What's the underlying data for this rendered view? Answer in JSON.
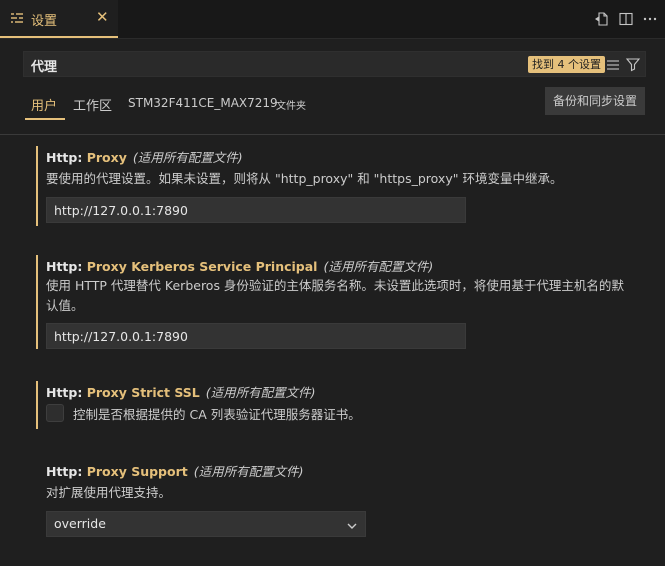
{
  "tab": {
    "label": "设置",
    "close": "✕"
  },
  "search": {
    "value": "代理",
    "badge": "找到 4 个设置"
  },
  "scopes": {
    "user": "用户",
    "workspace": "工作区",
    "folder": "STM32F411CE_MAX7219",
    "folder_suffix": "文件夹",
    "sync_button": "备份和同步设置"
  },
  "settings": [
    {
      "category": "Http: ",
      "key": "Proxy",
      "scope_note": "(适用所有配置文件)",
      "description": "要使用的代理设置。如果未设置，则将从 \"http_proxy\" 和 \"https_proxy\" 环境变量中继承。",
      "value": "http://127.0.0.1:7890"
    },
    {
      "category": "Http: ",
      "key": "Proxy Kerberos Service Principal",
      "scope_note": "(适用所有配置文件)",
      "description": "使用 HTTP 代理替代 Kerberos 身份验证的主体服务名称。未设置此选项时，将使用基于代理主机名的默认值。",
      "value": "http://127.0.0.1:7890"
    },
    {
      "category": "Http: ",
      "key": "Proxy Strict SSL",
      "scope_note": "(适用所有配置文件)",
      "checkbox_label": "控制是否根据提供的 CA 列表验证代理服务器证书。",
      "checked": false
    },
    {
      "category": "Http: ",
      "key": "Proxy Support",
      "scope_note": "(适用所有配置文件)",
      "description": "对扩展使用代理支持。",
      "value": "override"
    }
  ],
  "colors": {
    "accent": "#e5c07b",
    "background": "#1f1f1f"
  }
}
